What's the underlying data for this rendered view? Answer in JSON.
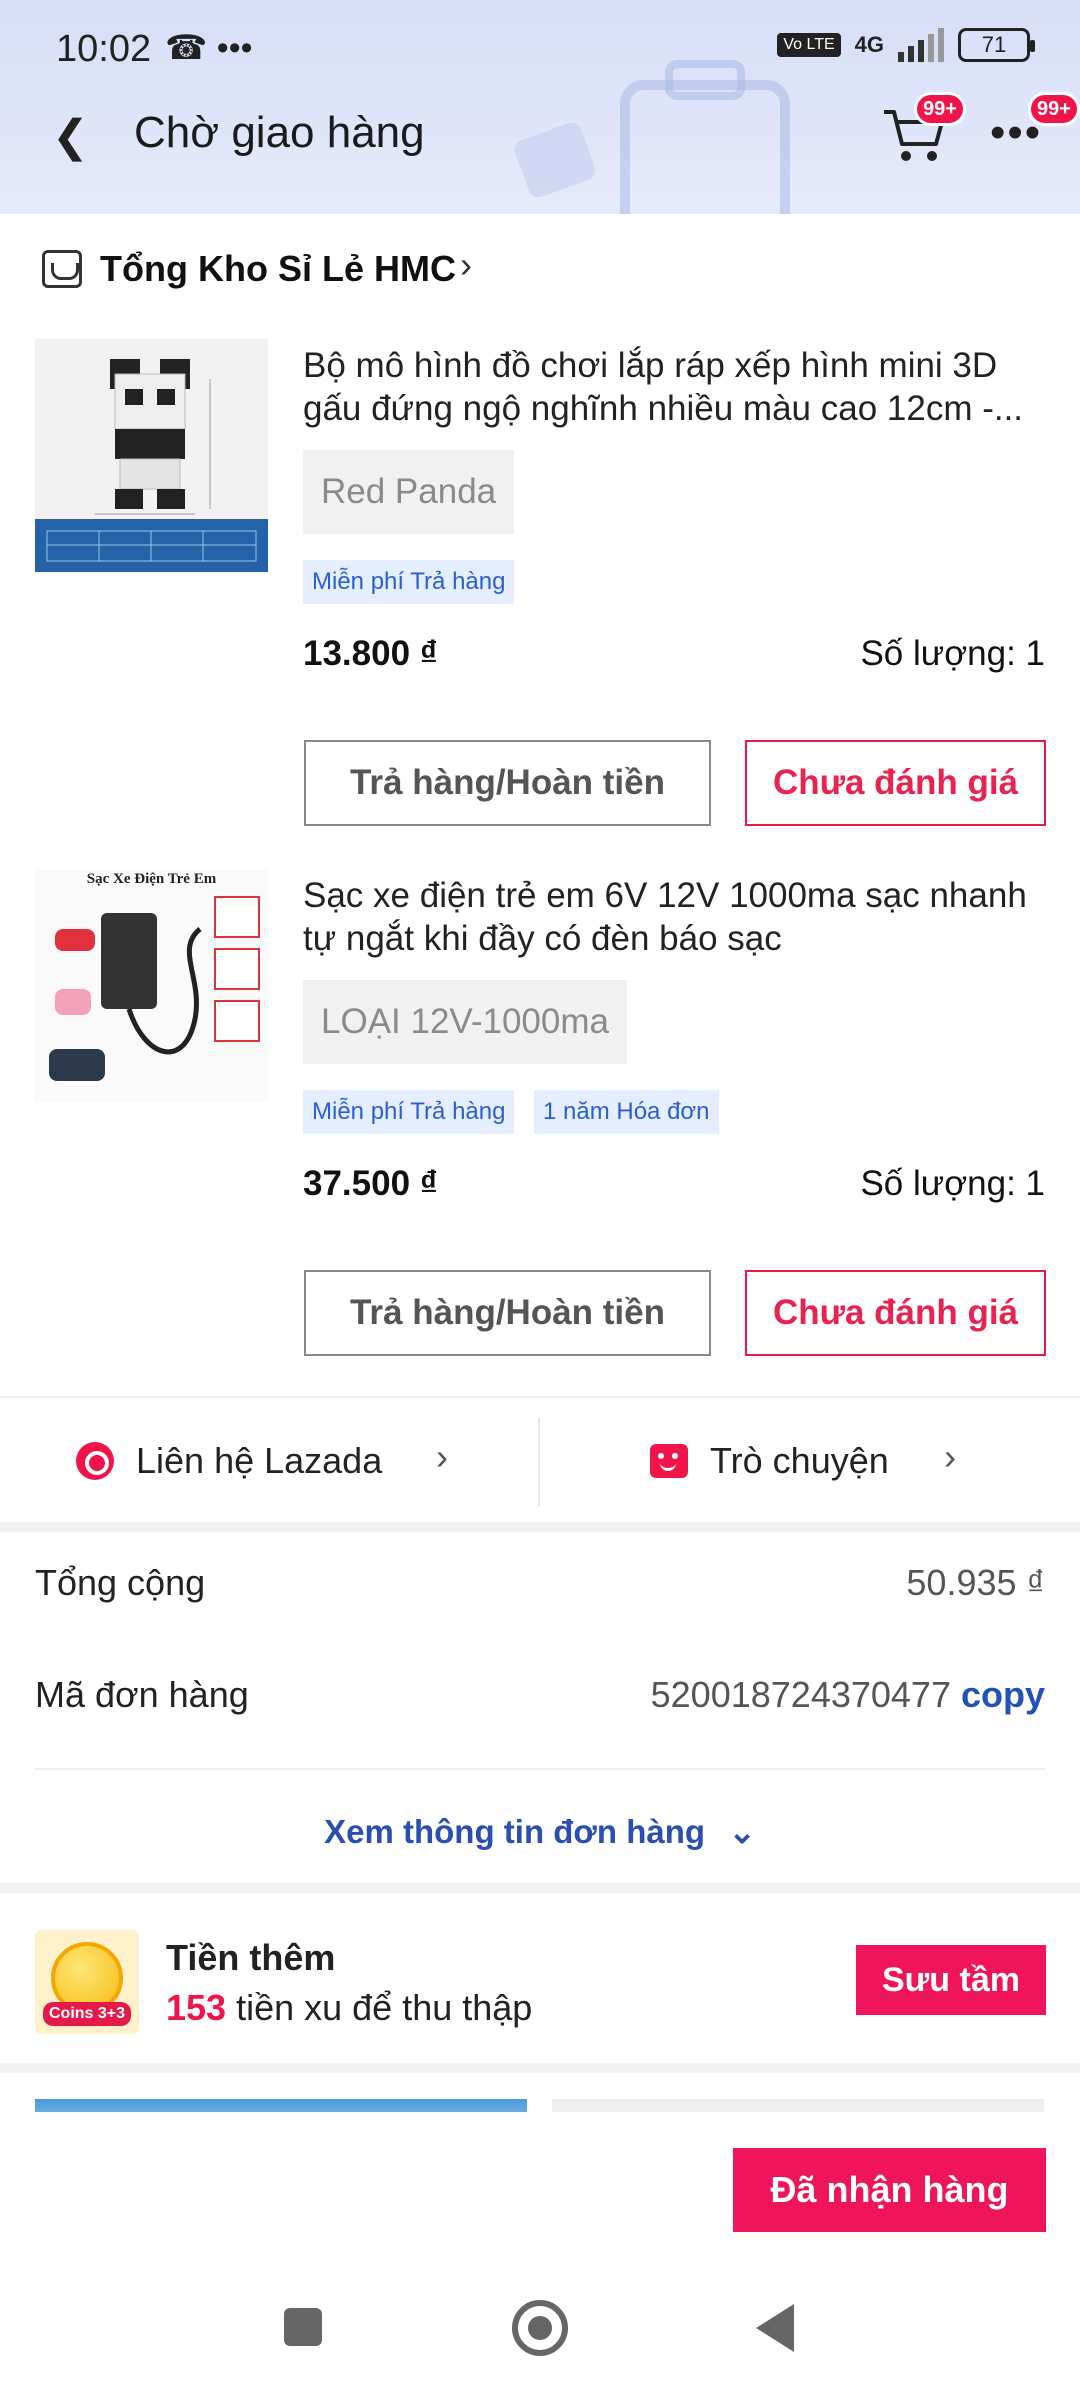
{
  "status_bar": {
    "time": "10:02",
    "extra": "☎ •••",
    "volte": "Vo LTE",
    "network": "4G",
    "battery": "71"
  },
  "header": {
    "title": "Chờ giao hàng",
    "cart_badge": "99+",
    "more_badge": "99+"
  },
  "shop": {
    "name": "Tổng Kho Sỉ Lẻ HMC"
  },
  "products": [
    {
      "name": "Bộ mô hình đồ chơi lắp ráp xếp hình mini 3D gấu đứng ngộ nghĩnh nhiều màu cao 12cm -...",
      "variant": "Red Panda",
      "tags": [
        "Miễn phí Trả hàng"
      ],
      "price": "13.800 ₫",
      "quantity": "Số lượng: 1",
      "return_label": "Trả hàng/Hoàn tiền",
      "rate_label": "Chưa đánh giá"
    },
    {
      "name": "Sạc xe điện trẻ em 6V 12V 1000ma sạc nhanh tự ngắt khi đầy có đèn báo sạc",
      "variant": "LOẠI 12V-1000ma",
      "tags": [
        "Miễn phí Trả hàng",
        "1 năm Hóa đơn"
      ],
      "price": "37.500 ₫",
      "quantity": "Số lượng: 1",
      "return_label": "Trả hàng/Hoàn tiền",
      "rate_label": "Chưa đánh giá",
      "thumb_caption": "Sạc Xe Điện Trẻ Em"
    }
  ],
  "contact": {
    "lazada": "Liên hệ Lazada",
    "chat": "Trò chuyện"
  },
  "summary": {
    "total_label": "Tổng cộng",
    "total_value": "50.935 ₫",
    "order_label": "Mã đơn hàng",
    "order_value": "520018724370477",
    "copy": "copy",
    "view_info": "Xem thông tin đơn hàng"
  },
  "coins": {
    "title": "Tiền thêm",
    "count": "153",
    "desc": " tiền xu để thu thập",
    "button": "Sưu tầm",
    "img_label": "Coins 3+3"
  },
  "footer": {
    "received": "Đã nhận hàng"
  },
  "colors": {
    "accent": "#f0145a",
    "link": "#2a4fb0",
    "tag_bg": "#e4eefe"
  }
}
